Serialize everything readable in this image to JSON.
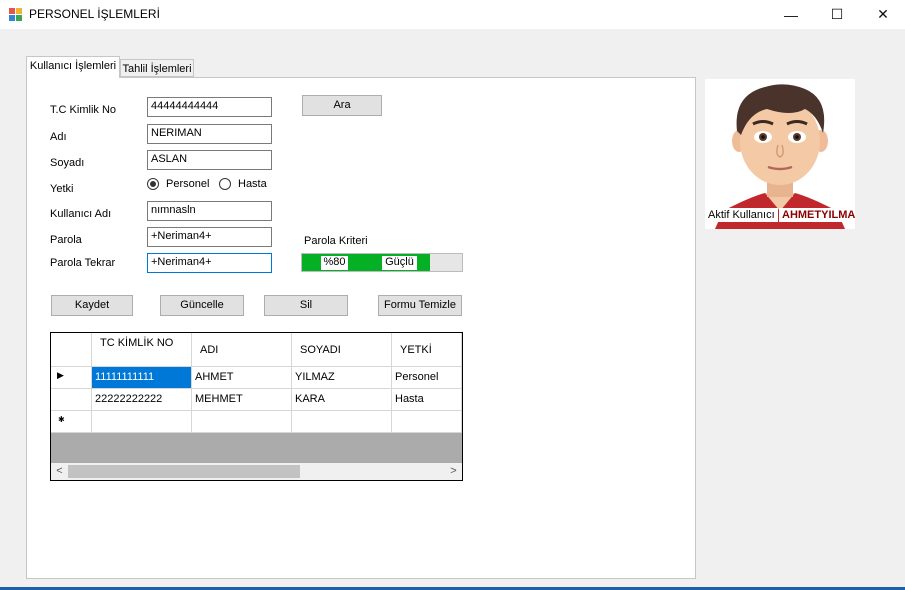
{
  "window": {
    "title": "PERSONEL İŞLEMLERİ",
    "minimize": "—",
    "maximize": "☐",
    "close": "✕"
  },
  "tabs": [
    {
      "label": "Kullanıcı İşlemleri",
      "active": true
    },
    {
      "label": "Tahlil İşlemleri",
      "active": false
    }
  ],
  "form": {
    "tc_label": "T.C Kimlik No",
    "tc_value": "44444444444",
    "search_button": "Ara",
    "name_label": "Adı",
    "name_value": "NERIMAN",
    "surname_label": "Soyadı",
    "surname_value": "ASLAN",
    "role_label": "Yetki",
    "role_option_1": "Personel",
    "role_option_2": "Hasta",
    "role_selected": "Personel",
    "username_label": "Kullanıcı Adı",
    "username_value": "nımnasln",
    "password_label": "Parola",
    "password_value": "+Neriman4+",
    "password_repeat_label": "Parola Tekrar",
    "password_repeat_value": "+Neriman4+",
    "criteria_label": "Parola Kriteri",
    "strength_percent_text": "%80",
    "strength_text": "Güçlü",
    "strength_value": 0.8
  },
  "actions": {
    "save": "Kaydet",
    "update": "Güncelle",
    "delete": "Sil",
    "clear": "Formu Temizle"
  },
  "grid": {
    "columns": [
      "TC KİMLİK NO",
      "ADI",
      "SOYADI",
      "YETKİ"
    ],
    "rows": [
      [
        "11111111111",
        "AHMET",
        "YILMAZ",
        "Personel"
      ],
      [
        "22222222222",
        "MEHMET",
        "KARA",
        "Hasta"
      ]
    ],
    "current_row_glyph": "▶",
    "new_row_glyph": "✱",
    "scroll_left": "<",
    "scroll_right": ">"
  },
  "user_panel": {
    "active_user_label": "Aktif Kullanıcı",
    "active_user_name": "AHMETYILMAZ"
  },
  "colors": {
    "accent": "#0078d7",
    "progress": "#06b025",
    "username": "#8b0000"
  }
}
